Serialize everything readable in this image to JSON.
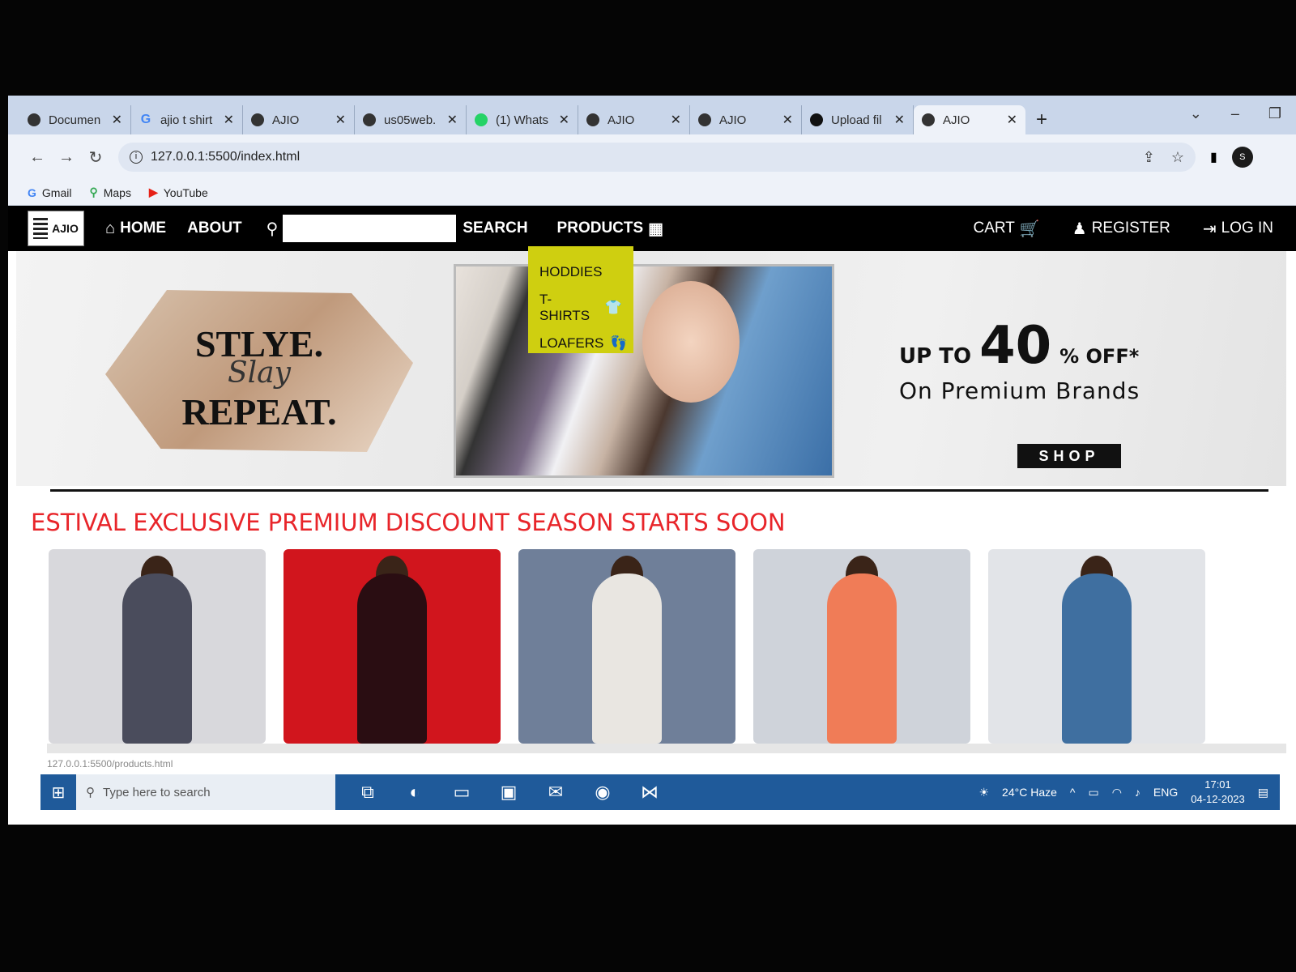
{
  "browser": {
    "tabs": [
      {
        "title": "Documen",
        "favicon": "globe-icon"
      },
      {
        "title": "ajio t shirt",
        "favicon": "google-icon"
      },
      {
        "title": "AJIO",
        "favicon": "globe-icon"
      },
      {
        "title": "us05web.",
        "favicon": "globe-icon"
      },
      {
        "title": "(1) Whats",
        "favicon": "whatsapp-icon"
      },
      {
        "title": "AJIO",
        "favicon": "globe-icon"
      },
      {
        "title": "AJIO",
        "favicon": "globe-icon"
      },
      {
        "title": "Upload fil",
        "favicon": "github-icon"
      },
      {
        "title": "AJIO",
        "favicon": "globe-icon"
      }
    ],
    "url": "127.0.0.1:5500/index.html",
    "bookmarks": [
      "Gmail",
      "Maps",
      "YouTube"
    ],
    "profile_initial": "S",
    "status_url": "127.0.0.1:5500/products.html"
  },
  "site": {
    "logo_text": "AJIO",
    "nav": {
      "home": "HOME",
      "about": "ABOUT",
      "search_button": "SEARCH",
      "search_value": "",
      "products": "PRODUCTS",
      "cart": "CART",
      "register": "REGISTER",
      "login": "LOG IN"
    },
    "dropdown": [
      "HODDIES",
      "T-SHIRTS",
      "LOAFERS"
    ],
    "banner": {
      "slogan_1": "STLYE.",
      "slogan_2": "Slay",
      "slogan_3": "REPEAT.",
      "offer_upto": "UP TO",
      "offer_number": "40",
      "offer_pct": "% OFF*",
      "offer_line2": "On Premium Brands",
      "shop": "SHOP"
    },
    "marquee": "ESTIVAL EXCLUSIVE PREMIUM DISCOUNT SEASON STARTS SOON",
    "cards": [
      {
        "bg": "#d8d8dc",
        "dress": "#4a4c5c"
      },
      {
        "bg": "#d1151d",
        "dress": "#2a0d12"
      },
      {
        "bg": "#6f7f99",
        "dress": "#e9e6e1"
      },
      {
        "bg": "#cfd3da",
        "dress": "#f07c57"
      },
      {
        "bg": "#e2e4e8",
        "dress": "#3f6fa0"
      }
    ]
  },
  "taskbar": {
    "search_placeholder": "Type here to search",
    "weather": "24°C  Haze",
    "lang": "ENG",
    "time": "17:01",
    "date": "04-12-2023"
  }
}
